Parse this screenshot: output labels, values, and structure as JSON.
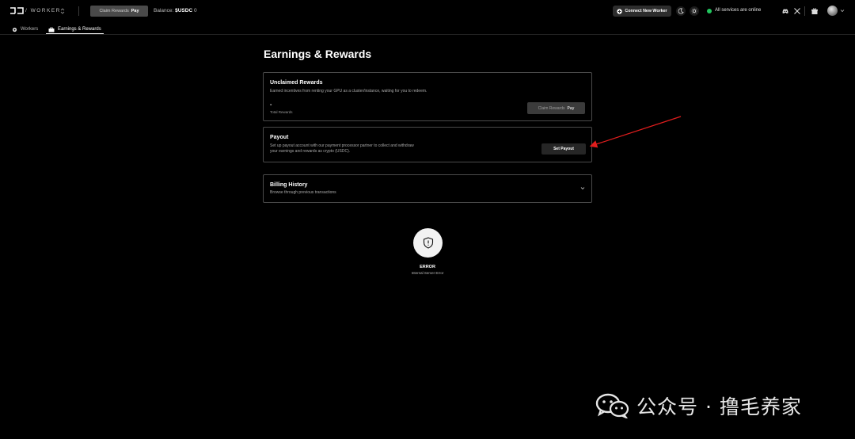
{
  "header": {
    "logo_text": "/ WORKER",
    "claim_rewards_label": "Claim Rewards",
    "pay_label": "Pay",
    "balance_label": "Balance:",
    "balance_currency": "$USDC",
    "balance_value": "0",
    "connect_worker_label": "Connect New Worker",
    "status_text": "All services are online",
    "status_color": "#22c55e"
  },
  "tabs": [
    {
      "label": "Workers",
      "active": false
    },
    {
      "label": "Earnings & Rewards",
      "active": true
    }
  ],
  "page": {
    "title": "Earnings & Rewards"
  },
  "unclaimed": {
    "title": "Unclaimed Rewards",
    "description": "Earned incentives from renting your GPU as a cluster/instance, waiting for you to redeem.",
    "value": "-",
    "total_label": "Total Rewards",
    "claim_label": "Claim Rewards",
    "pay_label": "Pay"
  },
  "payout": {
    "title": "Payout",
    "description_line1": "Set up payout account with our payment processor partner to collect and withdraw",
    "description_line2": "your earnings and rewards as crypto (USDC).",
    "button_label": "Set Payout"
  },
  "billing": {
    "title": "Billing History",
    "description": "Browse through previous transactions"
  },
  "error": {
    "title": "ERROR",
    "message": "Internal Server Error"
  },
  "watermark": {
    "text": "公众号 · 撸毛养家"
  },
  "icons": [
    "logo-icon",
    "switch-icon",
    "apple-pay-icon",
    "plus-icon",
    "moon-icon",
    "sun-icon",
    "discord-icon",
    "x-icon",
    "gift-icon",
    "avatar",
    "chevron-down-icon",
    "workers-icon",
    "briefcase-icon",
    "shield-icon",
    "wechat-icon"
  ],
  "colors": {
    "background": "#000000",
    "card_border": "#4a4a4a",
    "status_online": "#22c55e",
    "annotation_arrow": "#e11d1d"
  }
}
